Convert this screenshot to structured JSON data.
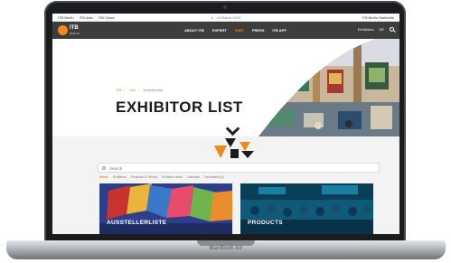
{
  "device": {
    "label": "MacBook Air"
  },
  "topbar": {
    "links": [
      "ITB Berlin",
      "ITB Asia",
      "ITB China"
    ],
    "center": "6 - 10 March 2023",
    "right": "ITB Berlin Startseite"
  },
  "nav": {
    "logo_text": "ITB",
    "logo_sub": "BERLIN",
    "items": [
      "ABOUT ITB",
      "EXPERT",
      "VISIT",
      "PRESS",
      "ITB APP"
    ],
    "active_index": 2,
    "right_items": [
      "Exhibitors",
      "DE"
    ]
  },
  "hero": {
    "breadcrumb": [
      "ITB",
      "Visit",
      "Exhibitor list"
    ],
    "title": "EXHIBITOR LIST"
  },
  "content": {
    "search_placeholder": "Search",
    "filters": [
      "Home",
      "Exhibitors",
      "Products & Trends",
      "Exhibitor news",
      "Calendar",
      "Favourites (0)"
    ],
    "active_filter_index": 0,
    "cards": [
      {
        "label": "AUSSTELLERLISTE"
      },
      {
        "label": "PRODUCTS"
      }
    ]
  },
  "colors": {
    "accent": "#f28a1a",
    "nav_bg": "#3d3d3d",
    "card_left": "#2d3f8c",
    "card_right": "#0e5a78"
  }
}
